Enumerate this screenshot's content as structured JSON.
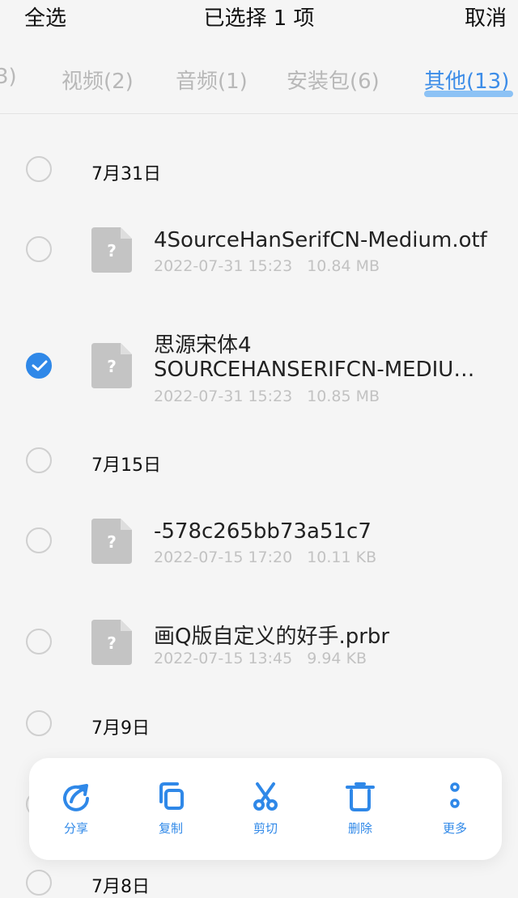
{
  "header": {
    "select_all": "全选",
    "title": "已选择 1 项",
    "cancel": "取消"
  },
  "tabs": [
    {
      "label": "3)",
      "active": false
    },
    {
      "label": "视频(2)",
      "active": false
    },
    {
      "label": "音频(1)",
      "active": false
    },
    {
      "label": "安装包(6)",
      "active": false
    },
    {
      "label": "其他(13)",
      "active": true
    }
  ],
  "groups": [
    {
      "date": "7月31日",
      "files": [
        {
          "name": "4SourceHanSerifCN-Medium.otf",
          "date": "2022-07-31 15:23",
          "size": "10.84 MB",
          "checked": false
        },
        {
          "name_line1": "思源宋体4",
          "name_line2": "SOURCEHANSERIFCN-MEDIU…",
          "date": "2022-07-31 15:23",
          "size": "10.85 MB",
          "checked": true
        }
      ]
    },
    {
      "date": "7月15日",
      "files": [
        {
          "name": "-578c265bb73a51c7",
          "date": "2022-07-15 17:20",
          "size": "10.11 KB",
          "checked": false
        },
        {
          "name": "画Q版自定义的好手.prbr",
          "date": "2022-07-15 13:45",
          "size": "9.94 KB",
          "checked": false
        }
      ]
    },
    {
      "date": "7月9日"
    },
    {
      "date": "7月8日"
    }
  ],
  "toolbar": {
    "share": "分享",
    "copy": "复制",
    "cut": "剪切",
    "delete": "删除",
    "more": "更多"
  },
  "colors": {
    "accent": "#2f88e8",
    "tab_active": "#3d8de8",
    "muted": "#c2c2c2"
  },
  "icons": {
    "file": "unknown-file-icon",
    "check": "check-icon"
  }
}
